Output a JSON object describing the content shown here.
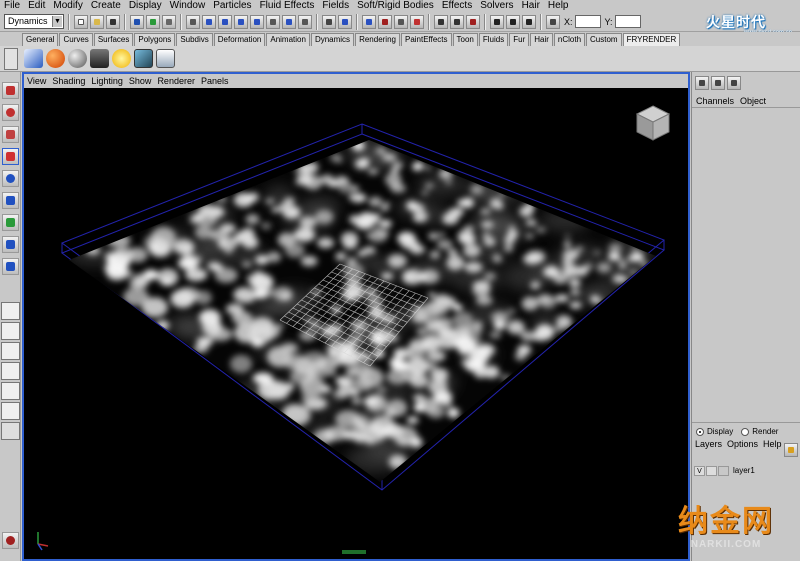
{
  "menubar": [
    "File",
    "Edit",
    "Modify",
    "Create",
    "Display",
    "Window",
    "Particles",
    "Fluid Effects",
    "Fields",
    "Soft/Rigid Bodies",
    "Effects",
    "Solvers",
    "Hair",
    "Help"
  ],
  "status_line": {
    "mode_menu_value": "Dynamics",
    "coord_x_label": "X:",
    "coord_y_label": "Y:"
  },
  "shelf_tabs": [
    "General",
    "Curves",
    "Surfaces",
    "Polygons",
    "Subdivs",
    "Deformation",
    "Animation",
    "Dynamics",
    "Rendering",
    "PaintEffects",
    "Toon",
    "Fluids",
    "Fur",
    "Hair",
    "nCloth",
    "Custom",
    "FRYRENDER"
  ],
  "shelf_active_tab": "FRYRENDER",
  "panel_menu": [
    "View",
    "Shading",
    "Lighting",
    "Show",
    "Renderer",
    "Panels"
  ],
  "channel_box": {
    "tabs": [
      "Channels",
      "Object"
    ]
  },
  "layer_editor": {
    "display_label": "Display",
    "render_label": "Render",
    "menu": [
      "Layers",
      "Options",
      "Help"
    ],
    "layer_visible": "V",
    "layer_name": "layer1"
  },
  "watermark_top": "火星时代",
  "watermark_top_url": "www.hxsd.com.cn",
  "watermark_bottom": "纳金网",
  "watermark_bottom_url": "NARKII.COM",
  "colors": {
    "viewport_border": "#2f5fcf",
    "ui_bg": "#c8c8c8",
    "wm_orange": "#e88a1a"
  }
}
